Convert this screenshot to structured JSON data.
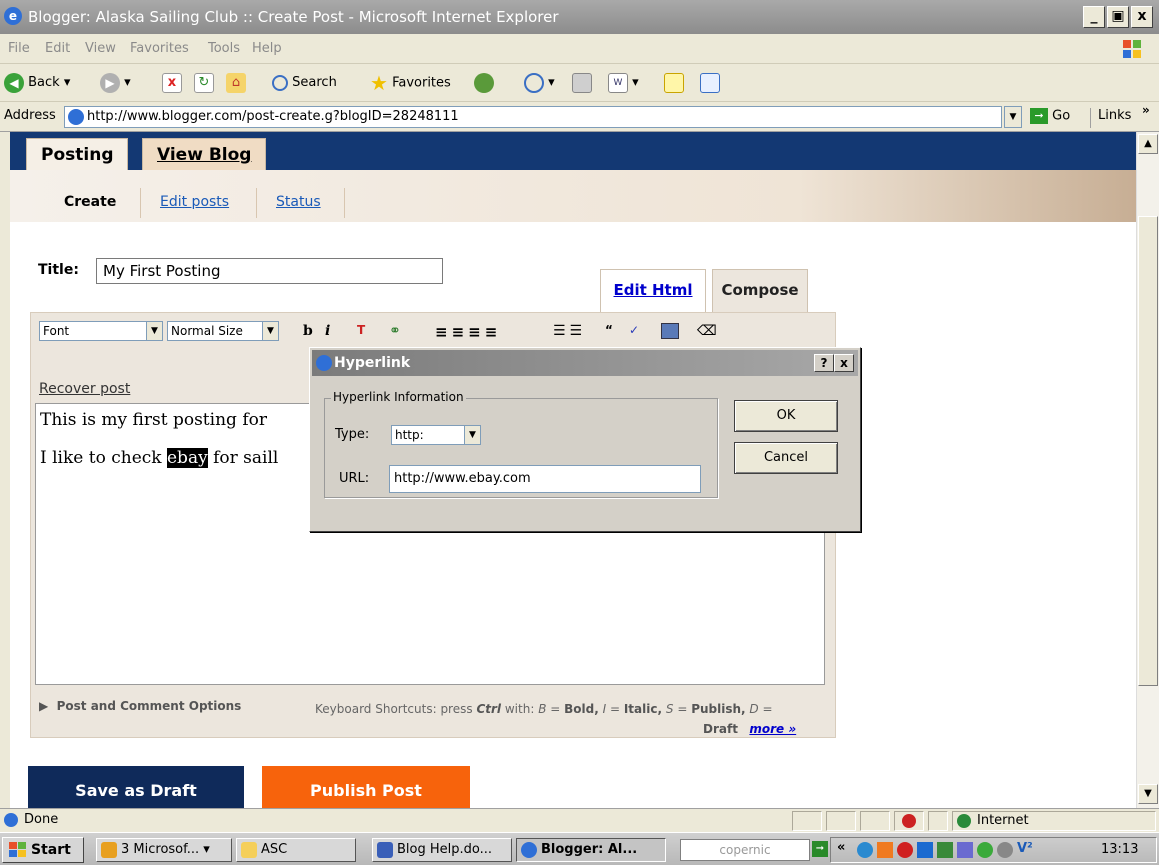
{
  "window": {
    "title": "Blogger: Alaska Sailing Club :: Create Post - Microsoft Internet Explorer",
    "min": "_",
    "max": "ᴴ",
    "close": "x"
  },
  "menu": [
    "File",
    "Edit",
    "View",
    "Favorites",
    "Tools",
    "Help"
  ],
  "toolbar": {
    "back": "Back",
    "search": "Search",
    "favorites": "Favorites"
  },
  "address": {
    "label": "Address",
    "url": "http://www.blogger.com/post-create.g?blogID=28248111",
    "go": "Go",
    "links": "Links",
    "links_chevron": "»"
  },
  "nav": {
    "tabs": [
      "Posting",
      "View Blog"
    ],
    "sub": [
      "Create",
      "Edit posts",
      "Status"
    ]
  },
  "editor": {
    "title_label": "Title:",
    "title_value": "My First Posting",
    "tab_edit_html": "Edit Html",
    "tab_compose": "Compose",
    "font_select": "Font",
    "size_select": "Normal Size",
    "recover": "Recover post",
    "line1": "This is my first posting for",
    "line2_pre": "I like to check ",
    "line2_sel": "ebay",
    "line2_post": " for saill",
    "options": "Post and Comment Options",
    "shortcuts_prefix": "Keyboard Shortcuts: press",
    "ctrl": "Ctrl",
    "shortcuts_with": "with:",
    "sc_b": "B",
    "sc_b_label": "Bold,",
    "sc_i": "I",
    "sc_i_label": "Italic,",
    "sc_s": "S",
    "sc_s_label": "Publish,",
    "sc_d": "D",
    "sc_d_label": "Draft",
    "more": "more »"
  },
  "buttons": {
    "draft": "Save as Draft",
    "publish": "Publish Post"
  },
  "dialog": {
    "title": "Hyperlink",
    "help": "?",
    "close": "x",
    "group": "Hyperlink Information",
    "type_label": "Type:",
    "type_value": "http:",
    "url_label": "URL:",
    "url_value": "http://www.ebay.com",
    "ok": "OK",
    "cancel": "Cancel"
  },
  "status": {
    "text": "Done",
    "zone": "Internet"
  },
  "taskbar": {
    "start": "Start",
    "tasks": [
      "3 Microsof...",
      "ASC",
      "Blog Help.do...",
      "Blogger: Al..."
    ],
    "search": "copernic",
    "chevron": "«",
    "clock": "13:13"
  }
}
